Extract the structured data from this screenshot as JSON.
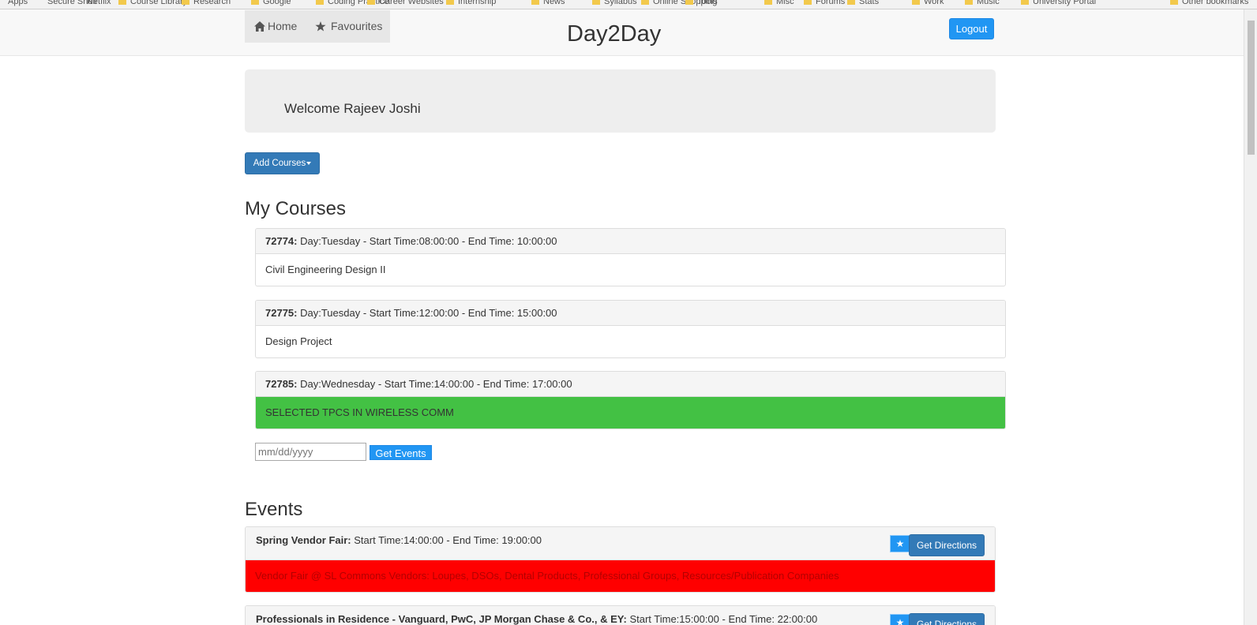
{
  "bookmarks": [
    {
      "label": "Apps"
    },
    {
      "label": "Secure Shell"
    },
    {
      "label": "Netflix"
    },
    {
      "label": "Course Library"
    },
    {
      "label": "Research"
    },
    {
      "label": "Google"
    },
    {
      "label": "Coding Practice"
    },
    {
      "label": "Career Websites"
    },
    {
      "label": "Internship"
    },
    {
      "label": "News"
    },
    {
      "label": "Syllabus"
    },
    {
      "label": "Online Shopping"
    },
    {
      "label": "Tools"
    },
    {
      "label": "Misc"
    },
    {
      "label": "Forums"
    },
    {
      "label": "Stats"
    },
    {
      "label": "Work"
    },
    {
      "label": "Music"
    },
    {
      "label": "University Portal"
    },
    {
      "label": "Other bookmarks"
    }
  ],
  "nav": {
    "home": "Home",
    "favourites": "Favourites",
    "brand": "Day2Day",
    "logout": "Logout"
  },
  "welcome": "Welcome Rajeev Joshi",
  "add_courses": "Add Courses",
  "my_courses_title": "My Courses",
  "courses": [
    {
      "id": "72774:",
      "schedule": "Day:Tuesday - Start Time:08:00:00 - End Time: 10:00:00",
      "name": "Civil Engineering Design II",
      "highlight": "none"
    },
    {
      "id": "72775:",
      "schedule": "Day:Tuesday - Start Time:12:00:00 - End Time: 15:00:00",
      "name": "Design Project",
      "highlight": "none"
    },
    {
      "id": "72785:",
      "schedule": "Day:Wednesday - Start Time:14:00:00 - End Time: 17:00:00",
      "name": "SELECTED TPCS IN WIRELESS COMM",
      "highlight": "#43c144"
    }
  ],
  "date_input": {
    "placeholder": "mm/dd/yyyy"
  },
  "get_events": "Get Events",
  "events_title": "Events",
  "events": [
    {
      "name": "Spring Vendor Fair:",
      "schedule": "Start Time:14:00:00 - End Time: 19:00:00",
      "description": "Vendor Fair @ SL Commons Vendors: Loupes, DSOs, Dental Products, Professional Groups, Resources/Publication Companies",
      "highlight": "#ff0000",
      "star": "★",
      "directions": "Get Directions"
    },
    {
      "name": "Professionals in Residence - Vanguard, PwC, JP Morgan Chase & Co., & EY:",
      "schedule": "Start Time:15:00:00 - End Time: 22:00:00",
      "description": "",
      "highlight": "none",
      "star": "★",
      "directions": "Get Directions"
    }
  ],
  "icons": [
    "home-icon",
    "star-icon"
  ],
  "colors": {
    "primary": "#337ab7",
    "accent": "#2196f3",
    "course_highlight": "#43c144",
    "event_highlight": "#ff0000"
  }
}
